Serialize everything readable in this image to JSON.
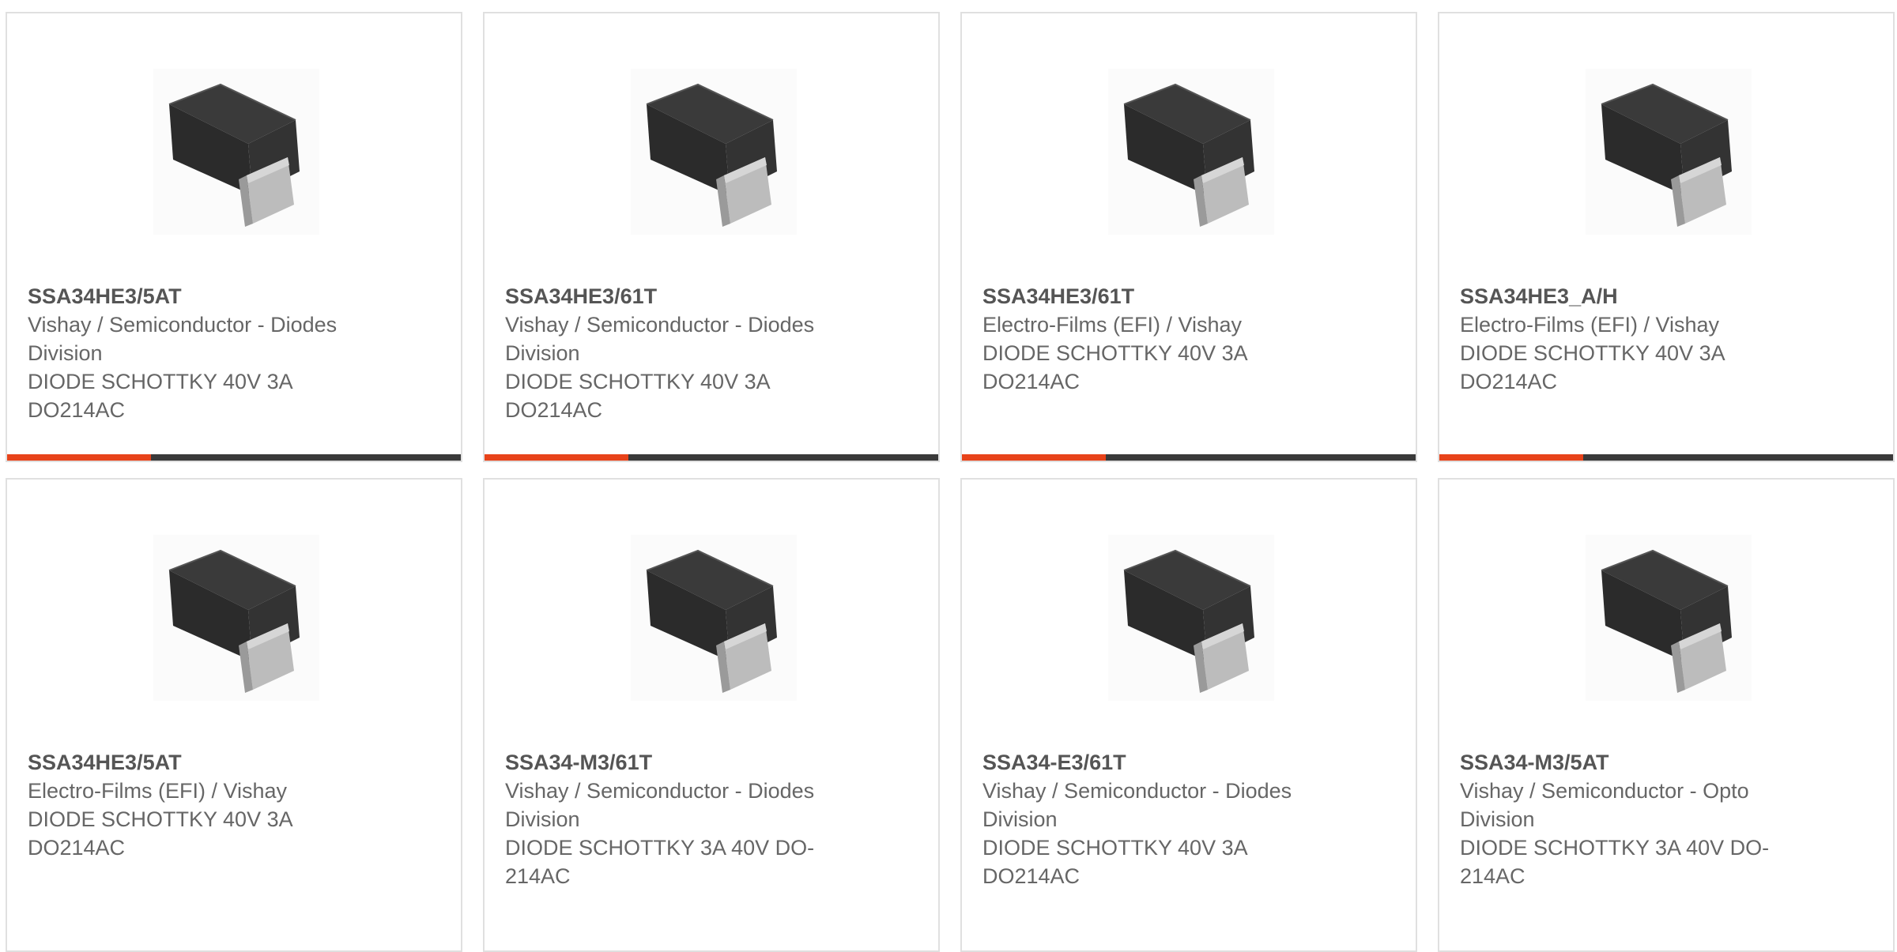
{
  "colors": {
    "accent": "#e8431a",
    "bar": "#3a3a3a",
    "text": "#666666",
    "border": "#e0e0e0"
  },
  "products": [
    {
      "part": "SSA34HE3/5AT",
      "lines": [
        "Vishay / Semiconductor - Diodes",
        "Division",
        "DIODE SCHOTTKY 40V 3A",
        "DO214AC"
      ],
      "image": "diode-package-icon"
    },
    {
      "part": "SSA34HE3/61T",
      "lines": [
        "Vishay / Semiconductor - Diodes",
        "Division",
        "DIODE SCHOTTKY 40V 3A",
        "DO214AC"
      ],
      "image": "diode-package-icon"
    },
    {
      "part": "SSA34HE3/61T",
      "lines": [
        "Electro-Films (EFI) / Vishay",
        "DIODE SCHOTTKY 40V 3A",
        "DO214AC"
      ],
      "image": "diode-package-icon"
    },
    {
      "part": "SSA34HE3_A/H",
      "lines": [
        "Electro-Films (EFI) / Vishay",
        "DIODE SCHOTTKY 40V 3A",
        "DO214AC"
      ],
      "image": "diode-package-icon"
    },
    {
      "part": "SSA34HE3/5AT",
      "lines": [
        "Electro-Films (EFI) / Vishay",
        "DIODE SCHOTTKY 40V 3A",
        "DO214AC"
      ],
      "image": "diode-package-icon"
    },
    {
      "part": "SSA34-M3/61T",
      "lines": [
        "Vishay / Semiconductor - Diodes",
        "Division",
        "DIODE SCHOTTKY 3A 40V DO-",
        "214AC"
      ],
      "image": "diode-package-icon"
    },
    {
      "part": "SSA34-E3/61T",
      "lines": [
        "Vishay / Semiconductor - Diodes",
        "Division",
        "DIODE SCHOTTKY 40V 3A",
        "DO214AC"
      ],
      "image": "diode-package-icon"
    },
    {
      "part": "SSA34-M3/5AT",
      "lines": [
        "Vishay / Semiconductor - Opto",
        "Division",
        "DIODE SCHOTTKY 3A 40V DO-",
        "214AC"
      ],
      "image": "diode-package-icon"
    }
  ]
}
